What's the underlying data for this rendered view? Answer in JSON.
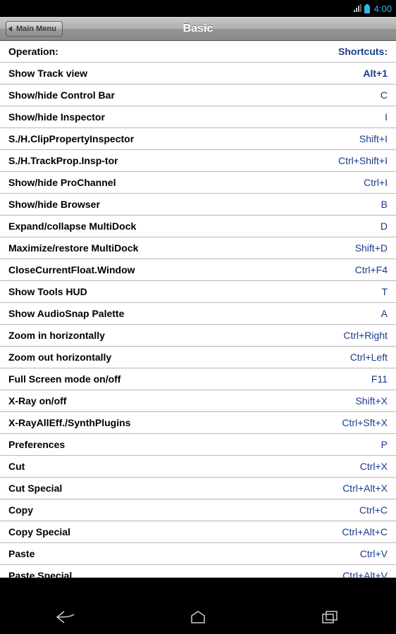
{
  "status": {
    "time": "4:00"
  },
  "header": {
    "main_menu": "Main Menu",
    "title": "Basic"
  },
  "table": {
    "header": {
      "operation": "Operation:",
      "shortcut": "Shortcuts:"
    },
    "rows": [
      {
        "operation": "Show Track view",
        "shortcut": "Alt+1"
      },
      {
        "operation": "Show/hide Control Bar",
        "shortcut": "C"
      },
      {
        "operation": "Show/hide Inspector",
        "shortcut": "I"
      },
      {
        "operation": "S./H.ClipPropertyInspector",
        "shortcut": "Shift+I"
      },
      {
        "operation": "S./H.TrackProp.Insp-tor",
        "shortcut": "Ctrl+Shift+I"
      },
      {
        "operation": "Show/hide ProChannel",
        "shortcut": "Ctrl+I"
      },
      {
        "operation": "Show/hide Browser",
        "shortcut": "B"
      },
      {
        "operation": "Expand/collapse MultiDock",
        "shortcut": "D"
      },
      {
        "operation": "Maximize/restore MultiDock",
        "shortcut": "Shift+D"
      },
      {
        "operation": "CloseCurrentFloat.Window",
        "shortcut": "Ctrl+F4"
      },
      {
        "operation": "Show Tools HUD",
        "shortcut": "T"
      },
      {
        "operation": "Show AudioSnap Palette",
        "shortcut": "A"
      },
      {
        "operation": "Zoom in horizontally",
        "shortcut": "Ctrl+Right"
      },
      {
        "operation": "Zoom out horizontally",
        "shortcut": "Ctrl+Left"
      },
      {
        "operation": "Full Screen mode on/off",
        "shortcut": "F11"
      },
      {
        "operation": "X-Ray on/off",
        "shortcut": "Shift+X"
      },
      {
        "operation": "X-RayAllEff./SynthPlugins",
        "shortcut": "Ctrl+Sft+X"
      },
      {
        "operation": "Preferences",
        "shortcut": "P"
      },
      {
        "operation": "Cut",
        "shortcut": "Ctrl+X"
      },
      {
        "operation": "Cut Special",
        "shortcut": "Ctrl+Alt+X"
      },
      {
        "operation": "Copy",
        "shortcut": "Ctrl+C"
      },
      {
        "operation": "Copy Special",
        "shortcut": "Ctrl+Alt+C"
      },
      {
        "operation": "Paste",
        "shortcut": "Ctrl+V"
      },
      {
        "operation": "Paste Special",
        "shortcut": "Ctrl+Alt+V"
      }
    ]
  }
}
